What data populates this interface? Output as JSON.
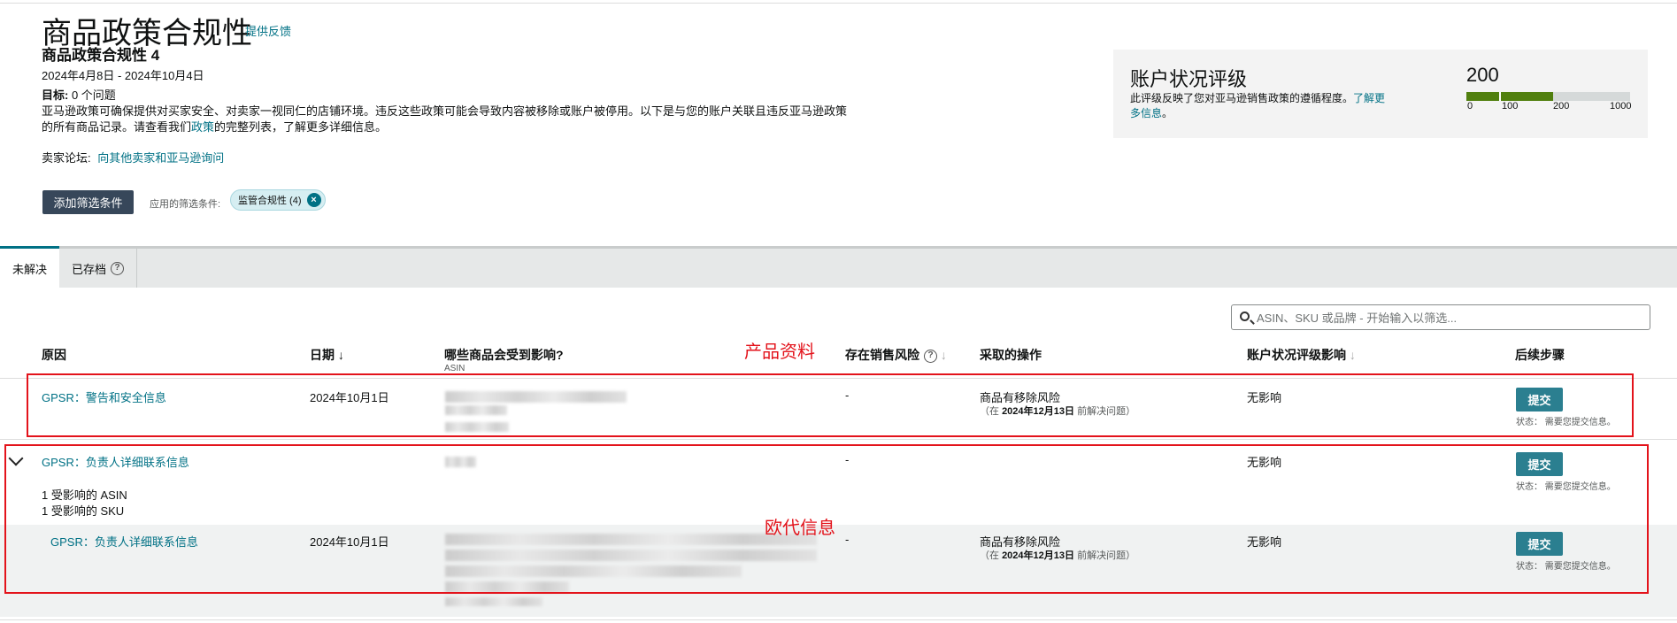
{
  "header": {
    "title": "商品政策合规性",
    "feedback_link": "提供反馈",
    "subtitle": "商品政策合规性 4",
    "date_range": "2024年4月8日 - 2024年10月4日",
    "target_label": "目标:",
    "target_value": "0 个问题",
    "description_1": "亚马逊政策可确保提供对买家安全、对卖家一视同仁的店铺环境。违反这些政策可能会导致内容被移除或账户被停用。以下是与您的账户关联且违反亚马逊政策的所有商品记录。请查看我们",
    "description_link": "政策",
    "description_2": "的完整列表，了解更多详细信息。",
    "forum_label": "卖家论坛:",
    "forum_link": "向其他卖家和亚马逊询问"
  },
  "filters": {
    "add_button": "添加筛选条件",
    "applied_label": "应用的筛选条件:",
    "chip_label": "监管合规性 (4)",
    "chip_remove_icon": "close-circle-icon"
  },
  "health": {
    "title": "账户状况评级",
    "desc": "此评级反映了您对亚马逊销售政策的遵循程度。",
    "desc_link": "了解更多信息",
    "desc_end": "。",
    "score": "200",
    "ticks": [
      "0",
      "100",
      "200",
      "1000"
    ],
    "score_color": "#507f0e"
  },
  "tabs": {
    "unresolved": "未解决",
    "archived": "已存档"
  },
  "search": {
    "placeholder": "ASIN、SKU 或品牌 - 开始输入以筛选..."
  },
  "table": {
    "headers": {
      "reason": "原因",
      "date": "日期",
      "affected": "哪些商品会受到影响?",
      "affected_sub": "ASIN",
      "risk": "存在销售风险",
      "action": "采取的操作",
      "impact": "账户状况评级影响",
      "next": "后续步骤"
    },
    "rows": [
      {
        "reason": "GPSR：警告和安全信息",
        "date": "2024年10月1日",
        "risk": "-",
        "action": "商品有移除风险",
        "action_note_pre": "（在 ",
        "action_note_date": "2024年12月13日",
        "action_note_post": " 前解决问题）",
        "impact": "无影响",
        "button": "提交",
        "status": "状态：  需要您提交信息。"
      },
      {
        "reason": "GPSR：负责人详细联系信息",
        "risk": "-",
        "impact": "无影响",
        "affected_asin": "1 受影响的 ASIN",
        "affected_sku": "1 受影响的 SKU",
        "button": "提交",
        "status": "状态：  需要您提交信息。"
      },
      {
        "reason": "GPSR：负责人详细联系信息",
        "date": "2024年10月1日",
        "risk": "-",
        "action": "商品有移除风险",
        "action_note_pre": "（在 ",
        "action_note_date": "2024年12月13日",
        "action_note_post": " 前解决问题）",
        "impact": "无影响",
        "button": "提交",
        "status": "状态：  需要您提交信息。"
      }
    ]
  },
  "annotations": {
    "label_1": "产品资料",
    "label_2": "欧代信息",
    "color": "#e3131b"
  }
}
